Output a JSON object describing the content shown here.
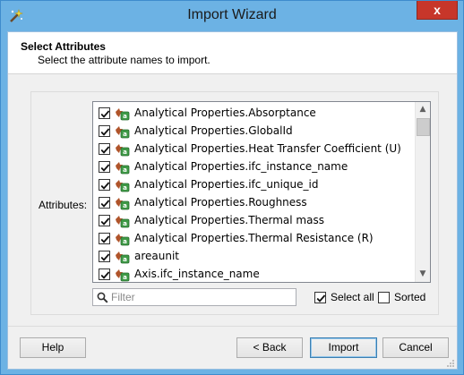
{
  "window": {
    "title": "Import Wizard",
    "close_label": "x"
  },
  "header": {
    "title": "Select Attributes",
    "subtitle": "Select the attribute names to import."
  },
  "attributes_label": "Attributes:",
  "attributes": [
    {
      "label": "Analytical Properties.Absorptance",
      "checked": true
    },
    {
      "label": "Analytical Properties.GlobalId",
      "checked": true
    },
    {
      "label": "Analytical Properties.Heat Transfer Coefficient (U)",
      "checked": true
    },
    {
      "label": "Analytical Properties.ifc_instance_name",
      "checked": true
    },
    {
      "label": "Analytical Properties.ifc_unique_id",
      "checked": true
    },
    {
      "label": "Analytical Properties.Roughness",
      "checked": true
    },
    {
      "label": "Analytical Properties.Thermal mass",
      "checked": true
    },
    {
      "label": "Analytical Properties.Thermal Resistance (R)",
      "checked": true
    },
    {
      "label": "areaunit",
      "checked": true
    },
    {
      "label": "Axis.ifc_instance_name",
      "checked": true
    }
  ],
  "filter": {
    "placeholder": "Filter",
    "value": ""
  },
  "options": {
    "select_all_label": "Select all",
    "select_all_checked": true,
    "sorted_label": "Sorted",
    "sorted_checked": false
  },
  "buttons": {
    "help": "Help",
    "back": "< Back",
    "import": "Import",
    "cancel": "Cancel"
  },
  "colors": {
    "title_bar": "#6cb2e4",
    "close_button": "#c7362a",
    "default_button_border": "#3c7fb1"
  },
  "icons": {
    "app": "wizard-icon",
    "row": "attribute-icon",
    "filter": "search-icon"
  }
}
